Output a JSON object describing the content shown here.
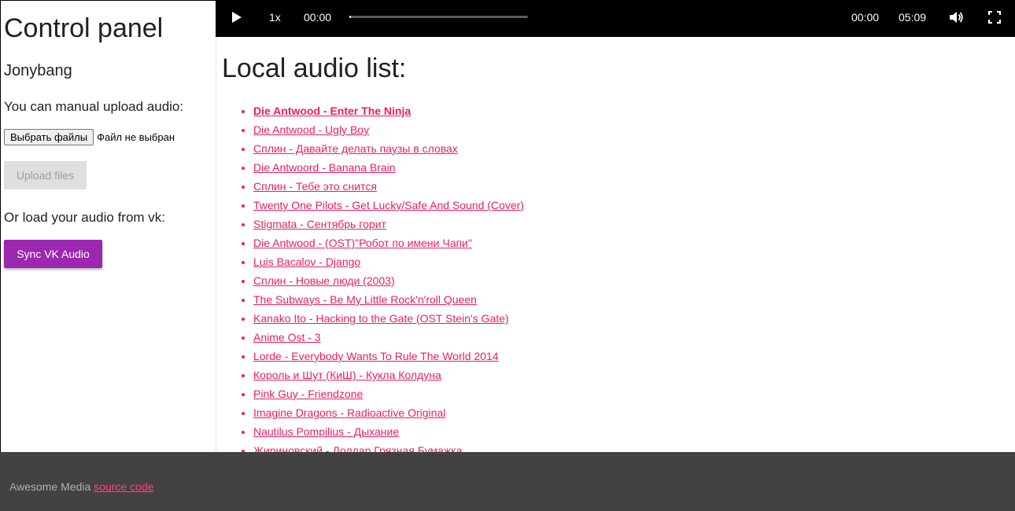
{
  "sidebar": {
    "title": "Control panel",
    "username": "Jonybang",
    "upload_prompt": "You can manual upload audio:",
    "file_button_label": "Выбрать файлы",
    "file_status": "Файл не выбран",
    "upload_button_label": "Upload files",
    "vk_prompt": "Or load your audio from vk:",
    "sync_button_label": "Sync VK Audio"
  },
  "player": {
    "speed": "1x",
    "current_time": "00:00",
    "elapsed_time": "00:00",
    "duration": "05:09",
    "progress_fraction": 0.0,
    "icons": [
      "play-icon",
      "volume-icon",
      "fullscreen-icon"
    ]
  },
  "main": {
    "heading": "Local audio list:",
    "active_index": 0,
    "tracks": [
      "Die Antwood - Enter The Ninja",
      "Die Antwood - Ugly Boy",
      "Сплин - Давайте делать паузы в словах",
      "Die Antwoord - Banana Brain",
      "Сплин - Тебе это снится",
      "Twenty One Pilots - Get Lucky/Safe And Sound (Cover)",
      "Stigmata - Сентябрь горит",
      "Die Antwood - (OST)\"Робот по имени Чапи\"",
      "Luis Bacalov - Django",
      "Сплин - Новые люди (2003)",
      "The Subways - Be My Little Rock'n'roll Queen",
      "Kanako Ito - Hacking to the Gate (OST Stein's Gate)",
      "Anime Ost - 3",
      "Lorde - Everybody Wants To Rule The World 2014",
      "Король и Шут (КиШ) - Кукла Колдуна",
      "Pink Guy - Friendzone",
      "Imagine Dragons - Radioactive Original",
      "Nautilus Pompilius - Дыхание",
      "Жириновский - Доллар Грязная Бумажка"
    ]
  },
  "footer": {
    "text": "Awesome Media",
    "link_label": "source code"
  },
  "colors": {
    "accent_pink": "#e91e63",
    "sync_purple": "#9c27b0",
    "footer_bg": "#424242",
    "player_bg": "#000000"
  }
}
